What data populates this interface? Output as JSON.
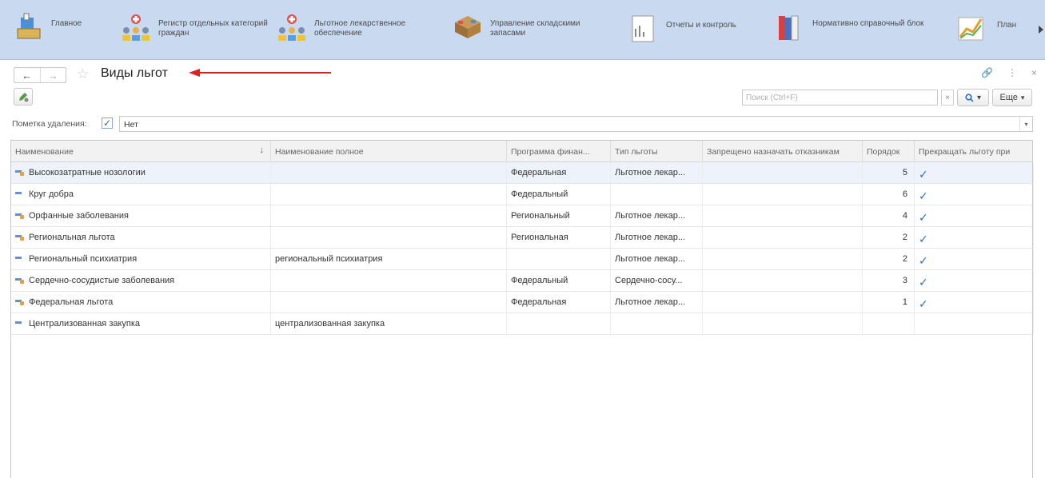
{
  "sections": [
    {
      "label": "Главное",
      "icon": "home-icon"
    },
    {
      "label": "Регистр отдельных категорий граждан",
      "icon": "people-icon"
    },
    {
      "label": "Льготное лекарственное обеспечение",
      "icon": "people-icon"
    },
    {
      "label": "Управление складскими запасами",
      "icon": "boxes-icon"
    },
    {
      "label": "Отчеты и контроль",
      "icon": "report-icon"
    },
    {
      "label": "Нормативно справочный блок",
      "icon": "books-icon"
    },
    {
      "label": "План",
      "icon": "chart-icon"
    }
  ],
  "form": {
    "title": "Виды льгот",
    "search_placeholder": "Поиск (Ctrl+F)",
    "more_label": "Еще",
    "filter_label": "Пометка удаления:",
    "filter_value": "Нет"
  },
  "table": {
    "columns": [
      "Наименование",
      "Наименование полное",
      "Программа финан...",
      "Тип льготы",
      "Запрещено назначать отказникам",
      "Порядок",
      "Прекращать льготу при"
    ],
    "rows": [
      {
        "name": "Высокозатратные нозологии",
        "full": "",
        "program": "Федеральная",
        "type": "Льготное лекар...",
        "forbid": "",
        "order": "5",
        "stop": "✓",
        "group": true,
        "selected": true
      },
      {
        "name": "Круг добра",
        "full": "",
        "program": "Федеральный",
        "type": "",
        "forbid": "",
        "order": "6",
        "stop": "✓",
        "group": false,
        "selected": false
      },
      {
        "name": "Орфанные заболевания",
        "full": "",
        "program": "Региональный",
        "type": "Льготное лекар...",
        "forbid": "",
        "order": "4",
        "stop": "✓",
        "group": true,
        "selected": false
      },
      {
        "name": "Региональная льгота",
        "full": "",
        "program": "Региональная",
        "type": "Льготное лекар...",
        "forbid": "",
        "order": "2",
        "stop": "✓",
        "group": true,
        "selected": false
      },
      {
        "name": "Региональный психиатрия",
        "full": "региональный психиатрия",
        "program": "",
        "type": "Льготное лекар...",
        "forbid": "",
        "order": "2",
        "stop": "✓",
        "group": false,
        "selected": false
      },
      {
        "name": "Сердечно-сосудистые заболевания",
        "full": "",
        "program": "Федеральный",
        "type": "Сердечно-сосу...",
        "forbid": "",
        "order": "3",
        "stop": "✓",
        "group": true,
        "selected": false
      },
      {
        "name": "Федеральная льгота",
        "full": "",
        "program": "Федеральная",
        "type": "Льготное лекар...",
        "forbid": "",
        "order": "1",
        "stop": "✓",
        "group": true,
        "selected": false
      },
      {
        "name": "Централизованная закупка",
        "full": "централизованная закупка",
        "program": "",
        "type": "",
        "forbid": "",
        "order": "",
        "stop": "",
        "group": false,
        "selected": false
      }
    ]
  }
}
